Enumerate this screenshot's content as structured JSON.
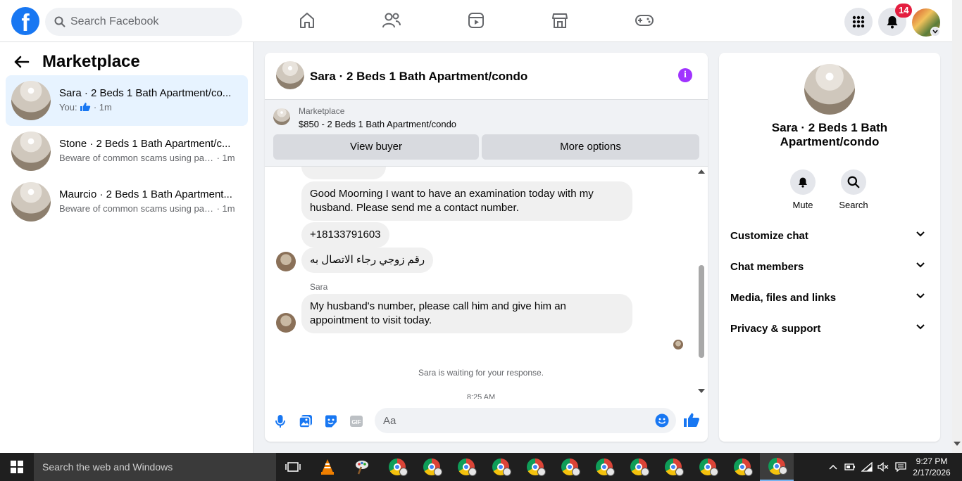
{
  "topbar": {
    "logo_letter": "f",
    "search_placeholder": "Search Facebook",
    "nav_icons": [
      "home-icon",
      "friends-icon",
      "video-icon",
      "marketplace-icon",
      "gaming-icon"
    ],
    "notification_count": "14",
    "accent": "#1877f2"
  },
  "sidebar": {
    "title": "Marketplace",
    "conversations": [
      {
        "title": "Sara · 2 Beds 1 Bath Apartment/co...",
        "preview_prefix": "You:",
        "preview": "",
        "time": "· 1m",
        "active": true
      },
      {
        "title": "Stone · 2 Beds 1 Bath Apartment/c...",
        "preview_prefix": "",
        "preview": "Beware of common scams using pay...",
        "time": " · 1m",
        "active": false
      },
      {
        "title": "Maurcio · 2 Beds 1 Bath Apartment...",
        "preview_prefix": "",
        "preview": "Beware of common scams using pay...",
        "time": " · 1m",
        "active": false
      }
    ]
  },
  "chat": {
    "title": "Sara · 2 Beds 1 Bath Apartment/condo",
    "marketplace_label": "Marketplace",
    "listing": "$850 - 2 Beds 1 Bath Apartment/condo",
    "view_buyer_label": "View buyer",
    "more_options_label": "More options",
    "messages": [
      {
        "text": "Good Moorning I want to have an examination today with my husband. Please send me a contact number."
      },
      {
        "text": "+18133791603"
      },
      {
        "text": "رقم زوجي رجاء الاتصال به"
      },
      {
        "sender": "Sara",
        "text": "My husband's number, please call him and give him an appointment to visit today."
      }
    ],
    "waiting_text": "Sara is waiting for your response.",
    "time_partial": "8:25 AM",
    "composer_placeholder": "Aa",
    "info_icon": "i"
  },
  "details": {
    "title": "Sara · 2 Beds 1 Bath Apartment/condo",
    "mute_label": "Mute",
    "search_label": "Search",
    "sections": [
      "Customize chat",
      "Chat members",
      "Media, files and links",
      "Privacy & support"
    ]
  },
  "taskbar": {
    "search_placeholder": "Search the web and Windows",
    "time": "9:27 PM",
    "date": "2/17/2026"
  }
}
